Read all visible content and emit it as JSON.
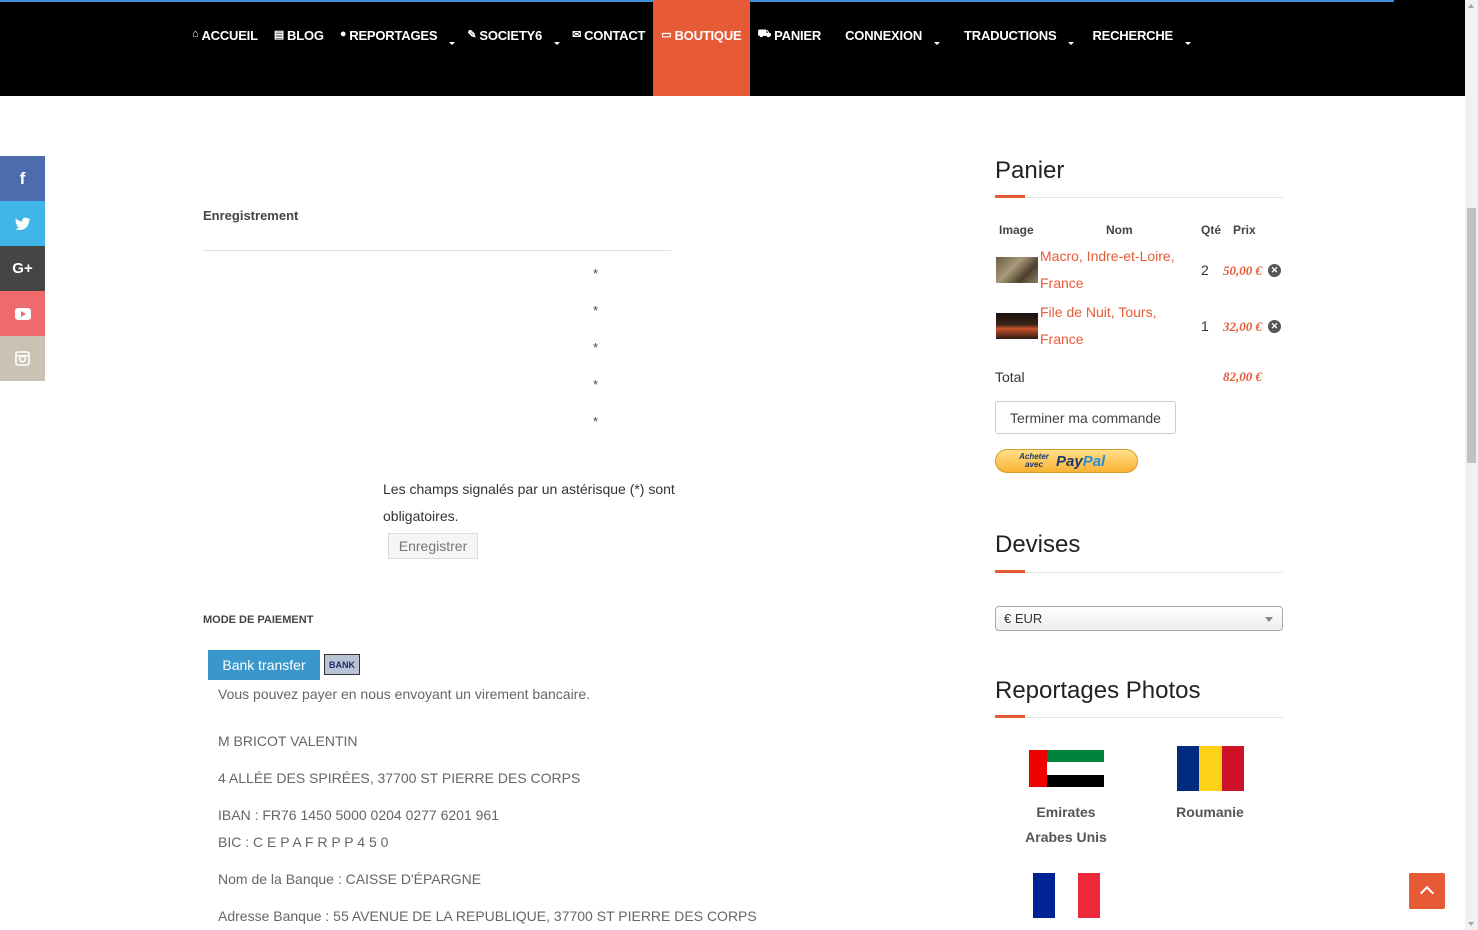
{
  "nav": {
    "items": [
      {
        "icon": "⌂",
        "label": "ACCUEIL"
      },
      {
        "icon": "▤",
        "label": "BLOG"
      },
      {
        "icon": "●",
        "label": "REPORTAGES"
      },
      {
        "icon": "✎",
        "label": "SOCIETY6"
      },
      {
        "icon": "✉",
        "label": "CONTACT"
      },
      {
        "icon": "▭",
        "label": "BOUTIQUE"
      },
      {
        "icon": "⛟",
        "label": "PANIER"
      },
      {
        "icon": "",
        "label": "CONNEXION"
      },
      {
        "icon": "",
        "label": "TRADUCTIONS"
      },
      {
        "icon": "",
        "label": "RECHERCHE"
      }
    ],
    "active_color": "#e65a36"
  },
  "social": [
    {
      "name": "facebook",
      "glyph": "f",
      "color": "#4c6cae"
    },
    {
      "name": "twitter",
      "glyph": "t",
      "color": "#3fb5e8"
    },
    {
      "name": "google-plus",
      "glyph": "G+",
      "color": "#454545"
    },
    {
      "name": "youtube",
      "glyph": "▶",
      "color": "#ef6b6b"
    },
    {
      "name": "instagram",
      "glyph": "◎",
      "color": "#c9c2b5"
    }
  ],
  "registration": {
    "title": "Enregistrement",
    "required_marker": "*",
    "note": "Les champs signalés par un astérisque (*) sont obligatoires.",
    "submit_label": "Enregistrer"
  },
  "payment": {
    "title": "MODE DE PAIEMENT",
    "method_label": "Bank transfer",
    "logo_text": "BANK",
    "description": "Vous pouvez payer en nous envoyant un virement bancaire.",
    "holder": "M BRICOT VALENTIN",
    "address": "4 ALLÉE DES SPIRÉES, 37700 ST PIERRE DES CORPS",
    "iban": "IBAN : FR76 1450 5000 0204 0277 6201 961",
    "bic": "BIC : C E P A F R P P 4 5 0",
    "bank_name": "Nom de la Banque : CAISSE D'ÉPARGNE",
    "bank_address": "Adresse Banque : 55 AVENUE DE LA REPUBLIQUE, 37700 ST PIERRE DES CORPS"
  },
  "cart": {
    "title": "Panier",
    "headers": {
      "image": "Image",
      "name": "Nom",
      "qty": "Qté",
      "price": "Prix"
    },
    "items": [
      {
        "name_line1": "Macro, Indre-et-Loire,",
        "name_line2": "France",
        "qty": "2",
        "price": "50,00 €"
      },
      {
        "name_line1": "File de Nuit, Tours,",
        "name_line2": "France",
        "qty": "1",
        "price": "32,00 €"
      }
    ],
    "total_label": "Total",
    "total_value": "82,00 €",
    "checkout_label": "Terminer ma commande",
    "paypal_small": "Acheter avec",
    "paypal_brand_1": "Pay",
    "paypal_brand_2": "Pal"
  },
  "currency": {
    "title": "Devises",
    "selected": "€ EUR"
  },
  "reportages": {
    "title": "Reportages Photos",
    "countries": [
      {
        "line1": "Emirates",
        "line2": "Arabes Unis"
      },
      {
        "line1": "Roumanie",
        "line2": ""
      }
    ]
  }
}
